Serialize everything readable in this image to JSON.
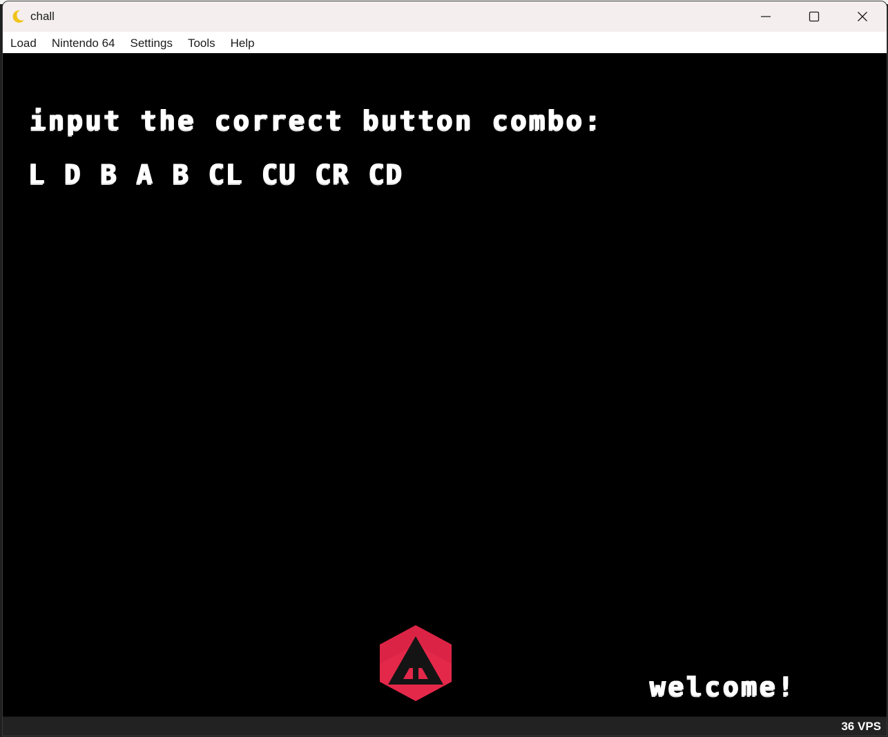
{
  "window": {
    "title": "chall",
    "icon": "crescent-moon-icon",
    "controls": [
      "minimize-icon",
      "maximize-icon",
      "close-icon"
    ]
  },
  "menubar": {
    "items": [
      "Load",
      "Nintendo 64",
      "Settings",
      "Tools",
      "Help"
    ]
  },
  "screen": {
    "prompt": "input the correct button combo:",
    "combo": "L D B A B CL CU CR CD",
    "welcome": "welcome!",
    "logo": "red-hexagon-a-logo",
    "colors": {
      "background": "#000000",
      "text": "#ffffff",
      "logo_red": "#e4284a",
      "logo_dark": "#141414"
    }
  },
  "statusbar": {
    "vps": "36 VPS"
  }
}
